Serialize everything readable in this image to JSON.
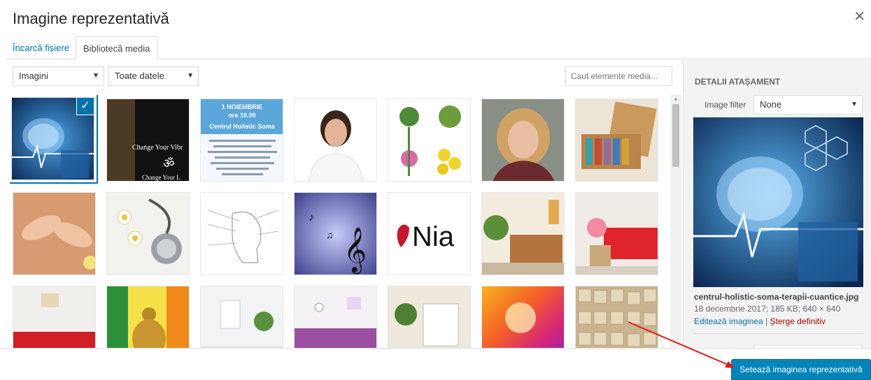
{
  "dialog": {
    "title": "Imagine reprezentativă",
    "close_icon": "close-icon"
  },
  "tabs": [
    {
      "label": "Încarcă fișiere"
    },
    {
      "label": "Bibliotecă media"
    }
  ],
  "filters": {
    "type": "Imagini",
    "date": "Toate datele",
    "search_placeholder": "Caut elemente media..."
  },
  "grid": {
    "selected_index": 0
  },
  "thumb_texts": {
    "chakra_top": "Change Your Vibr",
    "chakra_bottom": "Change Your L",
    "poster_date": "1 NOIEMBRIE",
    "poster_time": "ora 10.00",
    "poster_title": "Centrul Holistic Soma",
    "nia": "Nia"
  },
  "sidebar": {
    "heading": "DETALII ATAȘAMENT",
    "filter_label": "Image filter",
    "filter_value": "None",
    "filename": "centrul-holistic-soma-terapii-cuantice.jpg",
    "meta": "18 decembrie 2017; 185 KB; 640 × 640",
    "edit_link": "Editează imaginea",
    "separator": "|",
    "delete_link": "Șterge definitiv"
  },
  "footer": {
    "primary_button": "Setează imaginea reprezentativă"
  },
  "colors": {
    "accent": "#0073aa",
    "primary": "#0085ba",
    "delete": "#aa0000",
    "annotation": "#e0191e"
  }
}
